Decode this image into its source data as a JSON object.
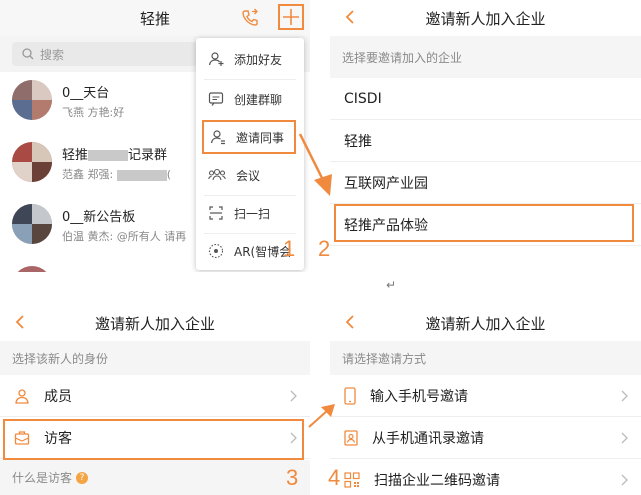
{
  "panel1": {
    "title": "轻推",
    "search_placeholder": "搜索",
    "chats": [
      {
        "name": "0__天台",
        "preview": "飞燕 方艳:好"
      },
      {
        "name_prefix": "轻推",
        "name_suffix": "记录群",
        "preview_prefix": "范鑫 郑强: ",
        "preview_suffix": "("
      },
      {
        "name": "0__新公告板",
        "preview": "伯温 黄杰: @所有人 请再"
      }
    ],
    "menu": [
      "添加好友",
      "创建群聊",
      "邀请同事",
      "会议",
      "扫一扫",
      "AR(智博会"
    ]
  },
  "panel2": {
    "title": "邀请新人加入企业",
    "section": "选择要邀请加入的企业",
    "companies": [
      "CISDI",
      "轻推",
      "互联网产业园",
      "轻推产品体验"
    ]
  },
  "panel3": {
    "title": "邀请新人加入企业",
    "section": "选择该新人的身份",
    "roles": [
      "成员",
      "访客"
    ],
    "help": "什么是访客"
  },
  "panel4": {
    "title": "邀请新人加入企业",
    "section": "请选择邀请方式",
    "methods": [
      "输入手机号邀请",
      "从手机通讯录邀请",
      "扫描企业二维码邀请"
    ]
  },
  "steps": [
    "1",
    "2",
    "3",
    "4"
  ],
  "colors": {
    "accent": "#f08a3e",
    "section_bg": "#f5f5f5"
  },
  "icons": [
    "phone-call-icon",
    "plus-icon",
    "search-icon",
    "add-friend-icon",
    "group-chat-icon",
    "invite-colleague-icon",
    "meeting-icon",
    "scan-icon",
    "ar-icon",
    "back-icon",
    "chevron-right-icon",
    "member-icon",
    "visitor-icon",
    "mobile-phone-icon",
    "contacts-icon",
    "qrcode-icon"
  ]
}
